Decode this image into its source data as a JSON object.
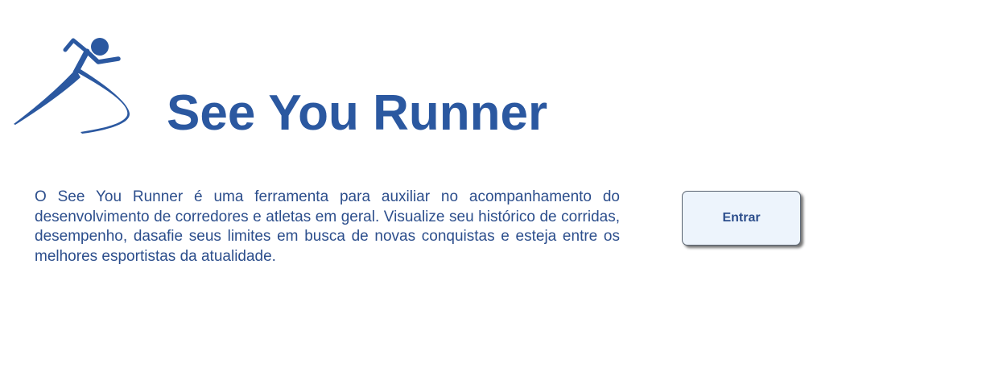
{
  "header": {
    "logo_icon": "runner-icon",
    "title": "See You Runner"
  },
  "main": {
    "description": "O See You Runner é uma ferramenta para auxiliar no acompanhamento do desenvolvimento de corredores e atletas em geral. Visualize seu histórico de corridas, desempenho, dasafie seus limites em busca de novas conquistas e esteja entre os melhores esportistas da atualidade.",
    "enter_button_label": "Entrar"
  },
  "colors": {
    "brand_blue": "#2b58a0",
    "text_blue": "#2c4e8c",
    "button_background": "#edf4fc"
  }
}
